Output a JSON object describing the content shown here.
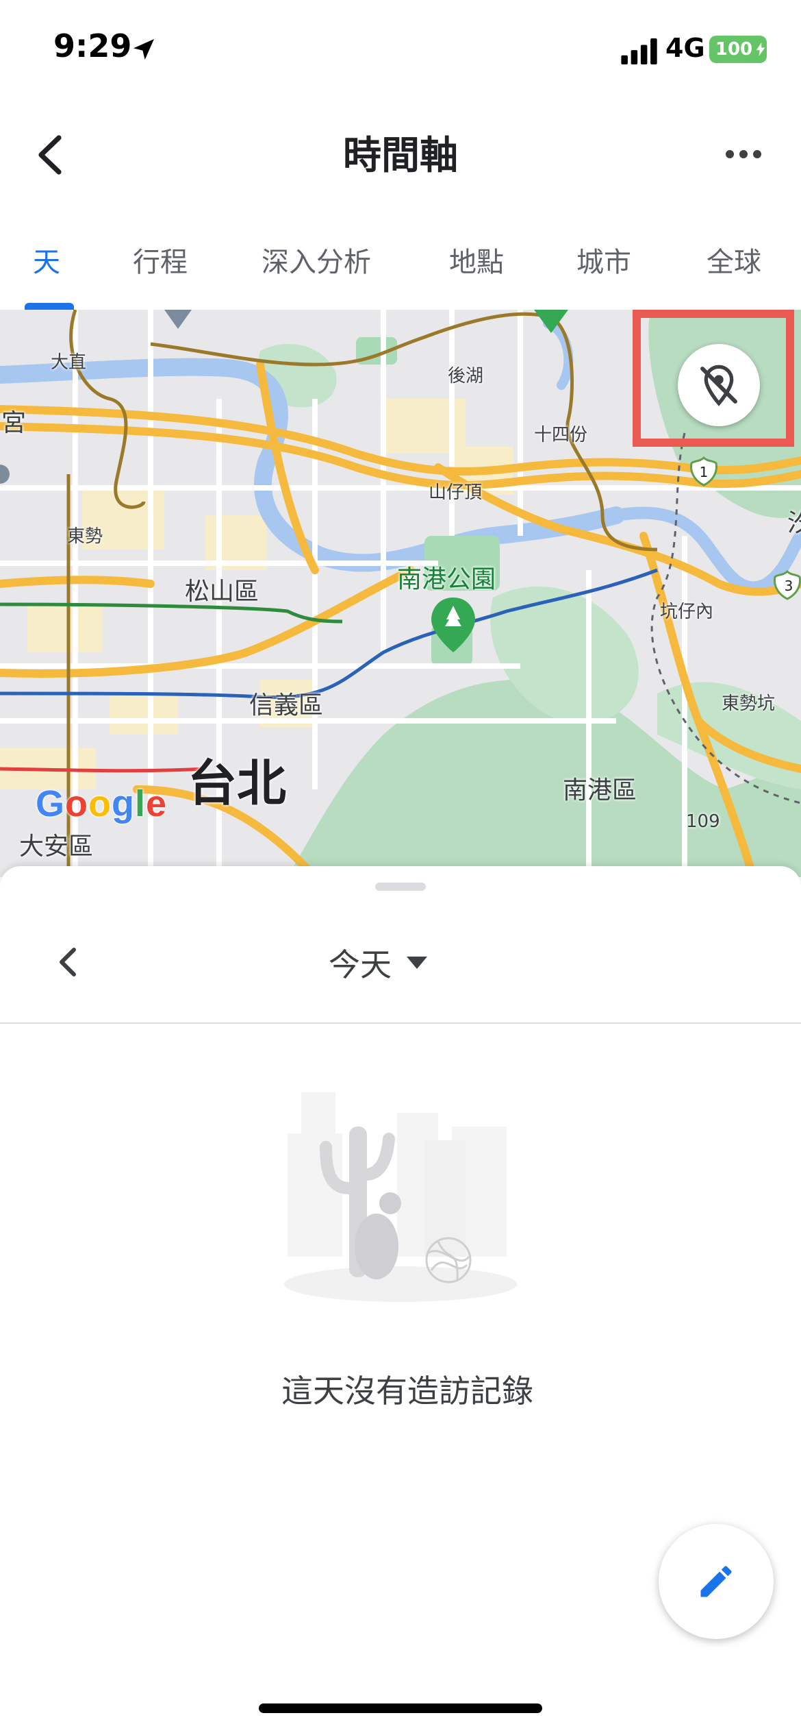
{
  "status_bar": {
    "time": "9:29",
    "network": "4G",
    "battery": "100"
  },
  "header": {
    "title": "時間軸",
    "back_icon": "chevron-left-icon",
    "more_icon": "more-horizontal-icon"
  },
  "tabs": [
    {
      "label": "天",
      "active": true
    },
    {
      "label": "行程",
      "active": false
    },
    {
      "label": "深入分析",
      "active": false
    },
    {
      "label": "地點",
      "active": false
    },
    {
      "label": "城市",
      "active": false
    },
    {
      "label": "全球",
      "active": false
    }
  ],
  "map": {
    "labels": {
      "dazhi": "大直",
      "houhu": "後湖",
      "gong": "宮",
      "shisifen": "十四份",
      "shanzaiding": "山仔頂",
      "dongshi": "東勢",
      "songshan": "松山區",
      "nangang_park": "南港公園",
      "kengzainei": "坑仔內",
      "xinyi": "信義區",
      "dongshikeng": "東勢坑",
      "taipei": "台北",
      "nangang": "南港區",
      "daan": "大安區",
      "road_109": "109",
      "route_1": "1",
      "route_3": "3",
      "edge_char": "汐"
    },
    "logo": "Google",
    "location_toggle_icon": "location-off-icon",
    "highlight_color": "#ea5a52"
  },
  "sheet": {
    "date_label": "今天",
    "prev_icon": "chevron-left-icon",
    "dropdown_icon": "caret-down-icon",
    "empty_message": "這天沒有造訪記錄",
    "fab_icon": "pencil-icon"
  },
  "colors": {
    "accent": "#1a73e8",
    "road_major": "#f5b93d",
    "water": "#a8c7f0",
    "park": "#a8dab5",
    "metro_blue": "#2962b8",
    "metro_green": "#2e8b3e",
    "metro_red": "#e04040"
  }
}
